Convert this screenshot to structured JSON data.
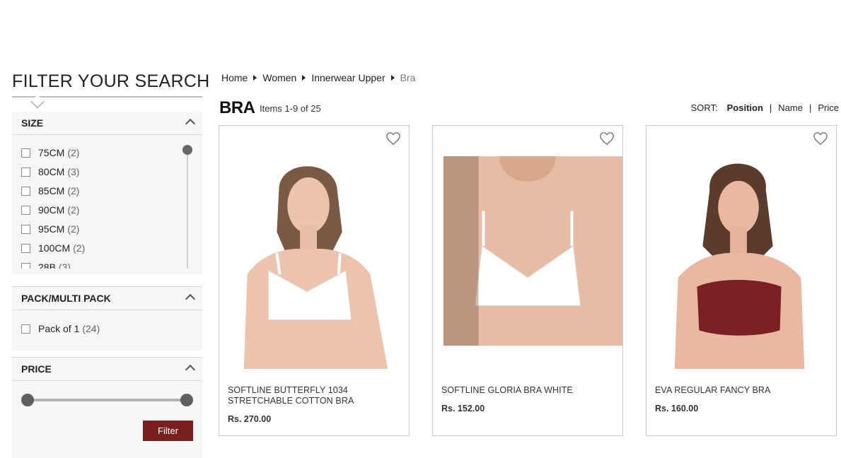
{
  "sidebar": {
    "title": "FILTER YOUR SEARCH",
    "size": {
      "title": "SIZE",
      "options": [
        {
          "label": "75CM",
          "count": "(2)"
        },
        {
          "label": "80CM",
          "count": "(3)"
        },
        {
          "label": "85CM",
          "count": "(2)"
        },
        {
          "label": "90CM",
          "count": "(2)"
        },
        {
          "label": "95CM",
          "count": "(2)"
        },
        {
          "label": "100CM",
          "count": "(2)"
        },
        {
          "label": "28B",
          "count": "(3)"
        }
      ]
    },
    "pack": {
      "title": "PACK/MULTI PACK",
      "options": [
        {
          "label": "Pack of 1",
          "count": "(24)"
        }
      ]
    },
    "price": {
      "title": "PRICE",
      "range_min_fraction": 0,
      "range_max_fraction": 1,
      "filter_label": "Filter"
    }
  },
  "breadcrumb": [
    "Home",
    "Women",
    "Innerwear Upper",
    "Bra"
  ],
  "main": {
    "title": "BRA",
    "items_count": "Items 1-9 of 25",
    "sort": {
      "label": "SORT:",
      "options": [
        "Position",
        "Name",
        "Price"
      ],
      "active": "Position"
    }
  },
  "products": [
    {
      "name": "SOFTLINE BUTTERFLY 1034 STRETCHABLE COTTON BRA",
      "price": "Rs. 270.00",
      "color": "white"
    },
    {
      "name": "SOFTLINE GLORIA BRA WHITE",
      "price": "Rs. 152.00",
      "color": "white"
    },
    {
      "name": "EVA REGULAR FANCY BRA",
      "price": "Rs. 160.00",
      "color": "maroon"
    }
  ],
  "colors": {
    "accent": "#7a1f1f",
    "panel_bg": "#f6f6f6"
  }
}
